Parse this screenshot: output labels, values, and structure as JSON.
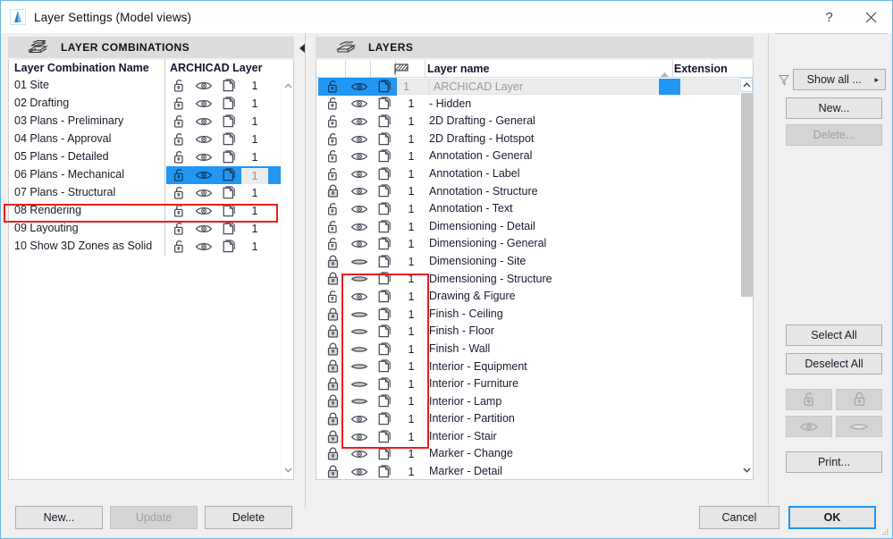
{
  "window": {
    "title": "Layer Settings (Model views)",
    "app_icon": "archicad-logo-icon",
    "help_label": "?",
    "close_label": "✕",
    "accent_color": "#2196f3",
    "annotation_color": "#ee1c1c"
  },
  "left_panel": {
    "header": {
      "icon": "layer-combinations-icon",
      "title": "LAYER COMBINATIONS"
    },
    "columns": [
      "Layer Combination Name",
      "ARCHICAD Layer"
    ],
    "rows": [
      {
        "name": "01 Site",
        "lock": "unlocked",
        "eye": "visible",
        "wire": "solid",
        "pen": "1",
        "selected": false
      },
      {
        "name": "02 Drafting",
        "lock": "unlocked",
        "eye": "visible",
        "wire": "solid",
        "pen": "1",
        "selected": false
      },
      {
        "name": "03 Plans - Preliminary",
        "lock": "unlocked",
        "eye": "visible",
        "wire": "solid",
        "pen": "1",
        "selected": false
      },
      {
        "name": "04 Plans - Approval",
        "lock": "unlocked",
        "eye": "visible",
        "wire": "solid",
        "pen": "1",
        "selected": false
      },
      {
        "name": "05 Plans - Detailed",
        "lock": "unlocked",
        "eye": "visible",
        "wire": "solid",
        "pen": "1",
        "selected": false
      },
      {
        "name": "06 Plans - Mechanical",
        "lock": "unlocked",
        "eye": "visible",
        "wire": "solid",
        "pen": "1",
        "selected": true
      },
      {
        "name": "07 Plans - Structural",
        "lock": "unlocked",
        "eye": "visible",
        "wire": "solid",
        "pen": "1",
        "selected": false
      },
      {
        "name": "08 Rendering",
        "lock": "unlocked",
        "eye": "visible",
        "wire": "solid",
        "pen": "1",
        "selected": false
      },
      {
        "name": "09 Layouting",
        "lock": "unlocked",
        "eye": "visible",
        "wire": "solid",
        "pen": "1",
        "selected": false
      },
      {
        "name": "10 Show 3D Zones as Solid",
        "lock": "unlocked",
        "eye": "visible",
        "wire": "solid",
        "pen": "1",
        "selected": false
      }
    ],
    "footer_buttons": [
      {
        "label": "New...",
        "enabled": true
      },
      {
        "label": "Update",
        "enabled": false
      },
      {
        "label": "Delete",
        "enabled": true
      }
    ],
    "collapse_arrow": "chevron-left-icon"
  },
  "right_panel": {
    "header": {
      "icon": "layers-stack-icon",
      "title": "LAYERS"
    },
    "columns": {
      "lock": "",
      "visibility": "",
      "wireframe": "",
      "pen": "hatch-pen-icon",
      "name": "Layer name",
      "extension": "Extension",
      "sort_indicator": "sort-ascending-caret"
    },
    "rows": [
      {
        "name": "ARCHICAD Layer",
        "lock": "unlocked",
        "eye": "visible",
        "wire": "solid",
        "pen": "1",
        "ext": "",
        "selected": true
      },
      {
        "name": "- Hidden",
        "lock": "unlocked",
        "eye": "visible",
        "wire": "solid",
        "pen": "1",
        "ext": "",
        "selected": false
      },
      {
        "name": "2D Drafting - General",
        "lock": "unlocked",
        "eye": "visible",
        "wire": "solid",
        "pen": "1",
        "ext": "",
        "selected": false
      },
      {
        "name": "2D Drafting - Hotspot",
        "lock": "unlocked",
        "eye": "visible",
        "wire": "solid",
        "pen": "1",
        "ext": "",
        "selected": false
      },
      {
        "name": "Annotation - General",
        "lock": "unlocked",
        "eye": "visible",
        "wire": "solid",
        "pen": "1",
        "ext": "",
        "selected": false
      },
      {
        "name": "Annotation - Label",
        "lock": "unlocked",
        "eye": "visible",
        "wire": "solid",
        "pen": "1",
        "ext": "",
        "selected": false
      },
      {
        "name": "Annotation - Structure",
        "lock": "locked",
        "eye": "visible",
        "wire": "solid",
        "pen": "1",
        "ext": "",
        "selected": false
      },
      {
        "name": "Annotation - Text",
        "lock": "unlocked",
        "eye": "visible",
        "wire": "solid",
        "pen": "1",
        "ext": "",
        "selected": false
      },
      {
        "name": "Dimensioning - Detail",
        "lock": "unlocked",
        "eye": "visible",
        "wire": "solid",
        "pen": "1",
        "ext": "",
        "selected": false
      },
      {
        "name": "Dimensioning - General",
        "lock": "unlocked",
        "eye": "visible",
        "wire": "solid",
        "pen": "1",
        "ext": "",
        "selected": false
      },
      {
        "name": "Dimensioning - Site",
        "lock": "locked",
        "eye": "hidden",
        "wire": "solid",
        "pen": "1",
        "ext": "",
        "selected": false
      },
      {
        "name": "Dimensioning - Structure",
        "lock": "locked",
        "eye": "hidden",
        "wire": "solid",
        "pen": "1",
        "ext": "",
        "selected": false
      },
      {
        "name": "Drawing & Figure",
        "lock": "unlocked",
        "eye": "visible",
        "wire": "solid",
        "pen": "1",
        "ext": "",
        "selected": false
      },
      {
        "name": "Finish - Ceiling",
        "lock": "locked",
        "eye": "hidden",
        "wire": "solid",
        "pen": "1",
        "ext": "",
        "selected": false
      },
      {
        "name": "Finish - Floor",
        "lock": "locked",
        "eye": "hidden",
        "wire": "solid",
        "pen": "1",
        "ext": "",
        "selected": false
      },
      {
        "name": "Finish - Wall",
        "lock": "locked",
        "eye": "hidden",
        "wire": "solid",
        "pen": "1",
        "ext": "",
        "selected": false
      },
      {
        "name": "Interior - Equipment",
        "lock": "locked",
        "eye": "hidden",
        "wire": "solid",
        "pen": "1",
        "ext": "",
        "selected": false
      },
      {
        "name": "Interior - Furniture",
        "lock": "locked",
        "eye": "hidden",
        "wire": "solid",
        "pen": "1",
        "ext": "",
        "selected": false
      },
      {
        "name": "Interior - Lamp",
        "lock": "locked",
        "eye": "hidden",
        "wire": "solid",
        "pen": "1",
        "ext": "",
        "selected": false
      },
      {
        "name": "Interior - Partition",
        "lock": "locked",
        "eye": "visible",
        "wire": "solid",
        "pen": "1",
        "ext": "",
        "selected": false
      },
      {
        "name": "Interior - Stair",
        "lock": "locked",
        "eye": "visible",
        "wire": "solid",
        "pen": "1",
        "ext": "",
        "selected": false
      },
      {
        "name": "Marker - Change",
        "lock": "locked",
        "eye": "visible",
        "wire": "solid",
        "pen": "1",
        "ext": "",
        "selected": false
      },
      {
        "name": "Marker - Detail",
        "lock": "locked",
        "eye": "visible",
        "wire": "solid",
        "pen": "1",
        "ext": "",
        "selected": false
      }
    ],
    "buttons": {
      "filter_icon": "funnel-icon",
      "show_all": "Show all ...",
      "show_all_caret": "▸",
      "new": "New...",
      "delete": "Delete...",
      "select_all": "Select All",
      "deselect_all": "Deselect All",
      "unlock_icon": "unlock-icon",
      "lock_icon": "lock-icon",
      "show_icon": "eye-open-icon",
      "hide_icon": "eye-closed-icon",
      "print": "Print..."
    }
  },
  "dialog_buttons": {
    "cancel": "Cancel",
    "ok": "OK"
  }
}
